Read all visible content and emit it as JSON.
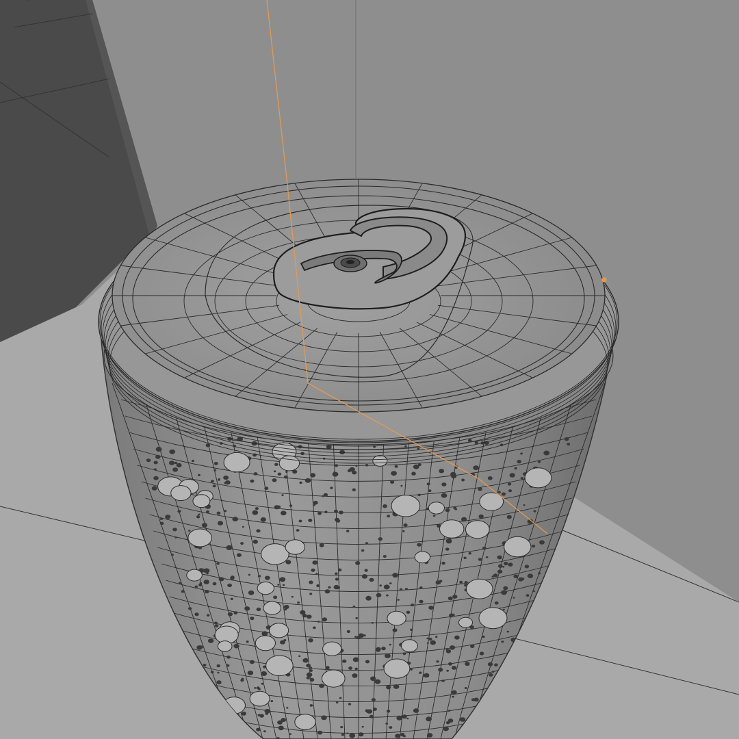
{
  "viewport": {
    "mode": "wireframe-overlay",
    "colors": {
      "background_wall": "#8e8e8e",
      "floor": "#a9a9a9",
      "dark_wall": "#4a4a4a",
      "mesh": "#8f8f8f",
      "wire": "#2a2a2a",
      "droplet": "#3a3a3a",
      "bead": "#b5b5b5",
      "selection_edge": "#e39a52",
      "grid_line": "#333333"
    }
  },
  "scene": {
    "object": "beverage-can",
    "features": [
      "pull-tab",
      "rivet",
      "rim",
      "condensation-droplets"
    ]
  }
}
